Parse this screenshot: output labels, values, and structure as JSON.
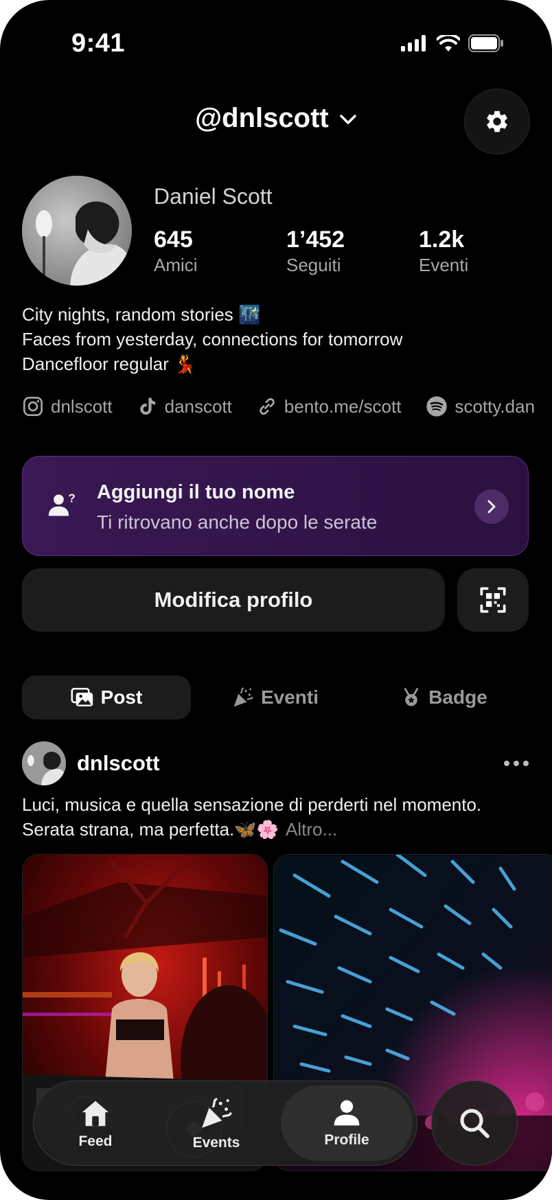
{
  "status_bar": {
    "time": "9:41"
  },
  "header": {
    "handle": "@dnlscott"
  },
  "profile": {
    "name": "Daniel Scott",
    "stats": [
      {
        "value": "645",
        "label": "Amici"
      },
      {
        "value": "1’452",
        "label": "Seguiti"
      },
      {
        "value": "1.2k",
        "label": "Eventi"
      }
    ],
    "bio": [
      "City nights, random stories 🌃",
      "Faces from yesterday, connections for tomorrow",
      "Dancefloor regular 💃"
    ],
    "links": [
      {
        "icon": "instagram-icon",
        "text": "dnlscott"
      },
      {
        "icon": "tiktok-icon",
        "text": "danscott"
      },
      {
        "icon": "link-icon",
        "text": "bento.me/scott"
      },
      {
        "icon": "spotify-icon",
        "text": "scotty.dan"
      }
    ]
  },
  "banner": {
    "title": "Aggiungi il tuo nome",
    "subtitle": "Ti ritrovano anche dopo le serate",
    "background": "#3a1854"
  },
  "actions": {
    "edit_label": "Modifica profilo"
  },
  "tabs": [
    {
      "label": "Post",
      "icon": "photos-icon",
      "active": true
    },
    {
      "label": "Eventi",
      "icon": "party-popper-icon",
      "active": false
    },
    {
      "label": "Badge",
      "icon": "medal-icon",
      "active": false
    }
  ],
  "post": {
    "username": "dnlscott",
    "caption_line1": "Luci, musica e quella sensazione di perderti nel momento.",
    "caption_line2": "Serata strana, ma perfetta.🦋🌸",
    "more_label": "Altro..."
  },
  "bottom_nav": [
    {
      "label": "Feed",
      "icon": "home-icon",
      "active": false
    },
    {
      "label": "Events",
      "icon": "party-popper-icon",
      "active": false
    },
    {
      "label": "Profile",
      "icon": "person-icon",
      "active": true
    }
  ],
  "search": {
    "icon": "search-icon"
  }
}
